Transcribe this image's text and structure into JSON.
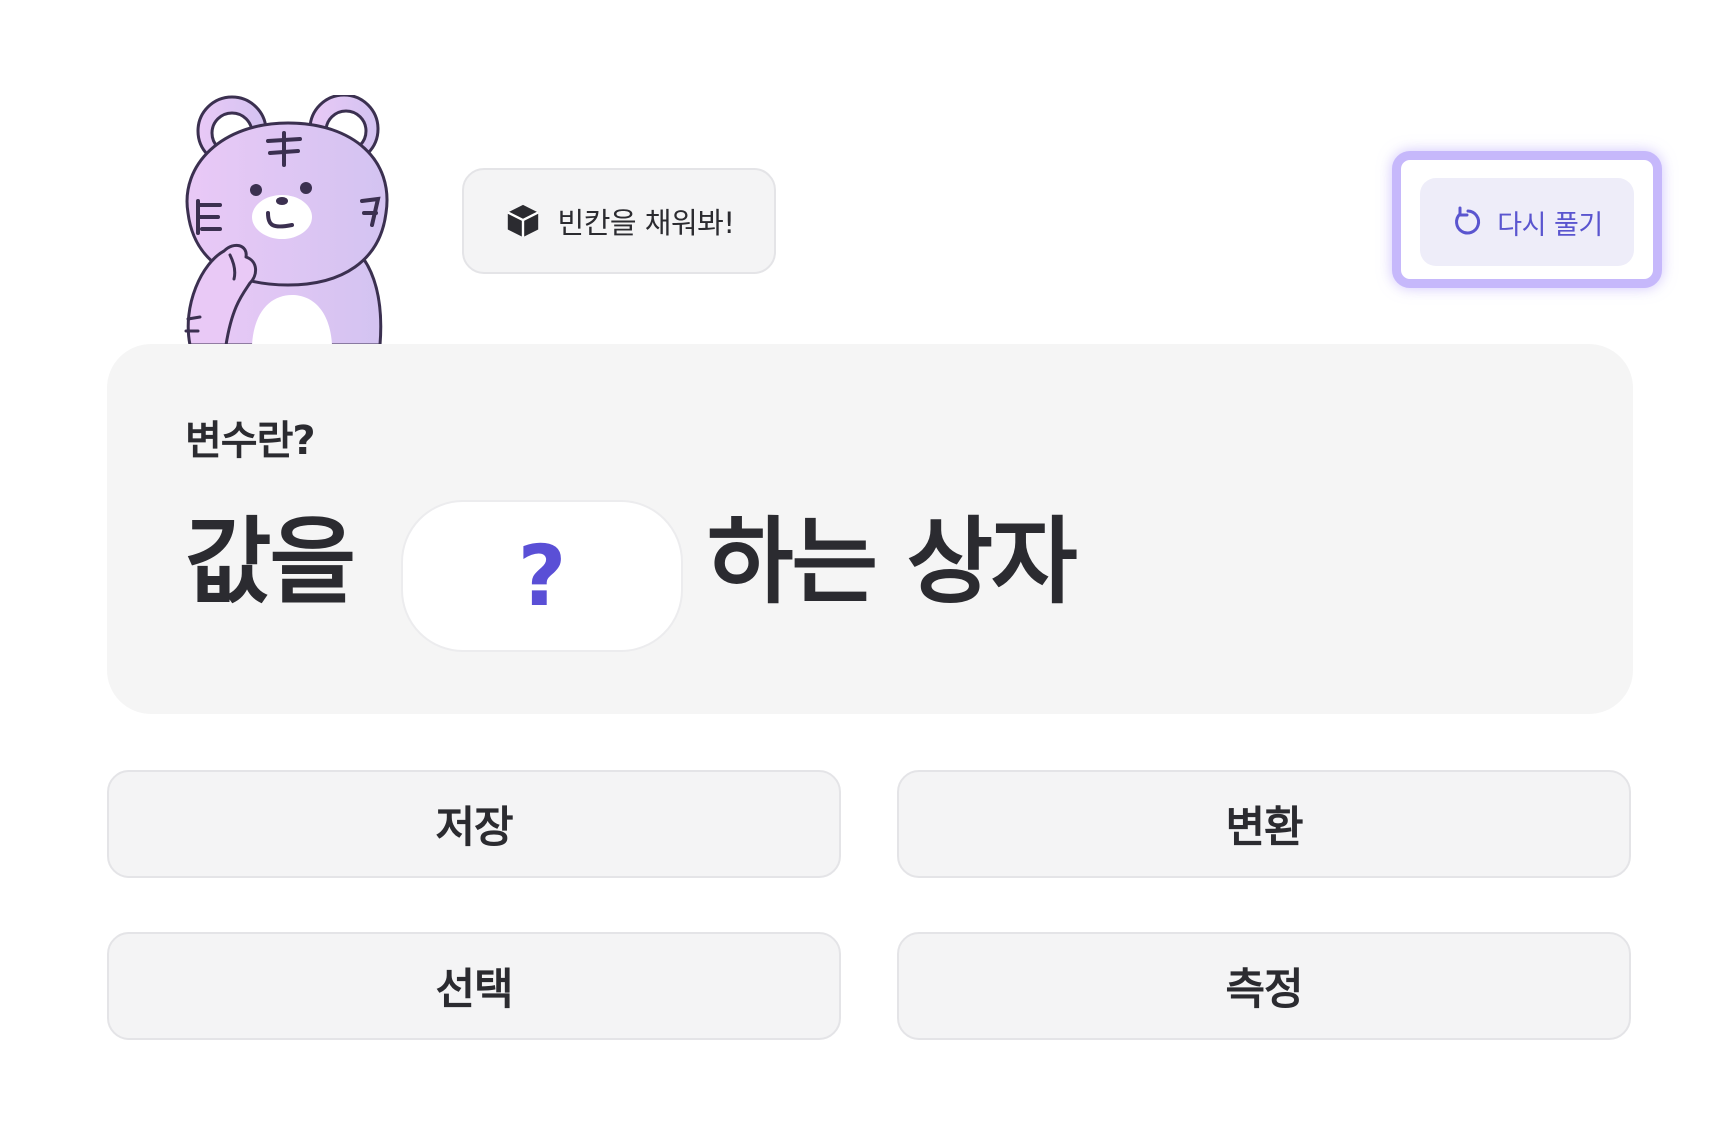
{
  "mascot": {
    "icon": "tiger-mascot-icon",
    "colors": {
      "body": "#dcc4f7",
      "outline": "#3b3050"
    }
  },
  "hint": {
    "icon": "cube-icon",
    "text": "빈칸을 채워봐!"
  },
  "retry": {
    "icon": "refresh-icon",
    "label": "다시 풀기",
    "accent": "#5a55cf"
  },
  "question": {
    "title": "변수란?",
    "before": "값을",
    "blank": "?",
    "after": "하는 상자",
    "blank_color": "#5a4fd6"
  },
  "choices": [
    "저장",
    "변환",
    "선택",
    "측정"
  ]
}
